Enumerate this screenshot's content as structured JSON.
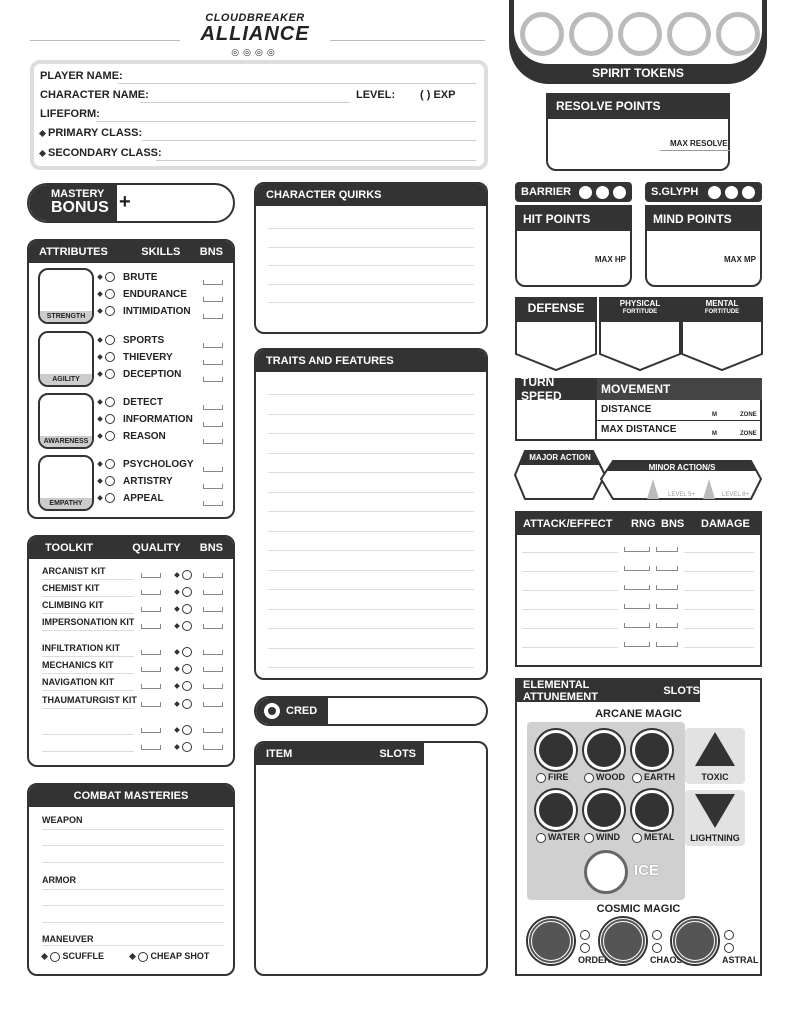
{
  "logo": {
    "line1": "CLOUDBREAKER",
    "line2": "ALLIANCE"
  },
  "identity": {
    "player": "PLAYER NAME:",
    "character": "CHARACTER NAME:",
    "level": "LEVEL:",
    "exp": "(      ) EXP",
    "lifeform": "LIFEFORM:",
    "primary": "PRIMARY CLASS:",
    "secondary": "SECONDARY CLASS:"
  },
  "spirit": {
    "label": "SPIRIT TOKENS"
  },
  "resolve": {
    "title": "RESOLVE POINTS",
    "max": "MAX RESOLVE"
  },
  "mastery": {
    "line1": "MASTERY",
    "line2": "BONUS",
    "plus": "+"
  },
  "attributes": {
    "h1": "ATTRIBUTES",
    "h2": "SKILLS",
    "h3": "BNS",
    "groups": [
      {
        "name": "STRENGTH",
        "skills": [
          "BRUTE",
          "ENDURANCE",
          "INTIMIDATION"
        ]
      },
      {
        "name": "AGILITY",
        "skills": [
          "SPORTS",
          "THIEVERY",
          "DECEPTION"
        ]
      },
      {
        "name": "AWARENESS",
        "skills": [
          "DETECT",
          "INFORMATION",
          "REASON"
        ]
      },
      {
        "name": "EMPATHY",
        "skills": [
          "PSYCHOLOGY",
          "ARTISTRY",
          "APPEAL"
        ]
      }
    ]
  },
  "toolkit": {
    "h1": "TOOLKIT",
    "h2": "QUALITY",
    "h3": "BNS",
    "items": [
      "ARCANIST KIT",
      "CHEMIST KIT",
      "CLIMBING KIT",
      "IMPERSONATION KIT",
      "INFILTRATION KIT",
      "MECHANICS KIT",
      "NAVIGATION KIT",
      "THAUMATURGIST KIT",
      "",
      ""
    ]
  },
  "combat": {
    "title": "COMBAT MASTERIES",
    "weapon": "WEAPON",
    "armor": "ARMOR",
    "maneuver": "MANEUVER",
    "scuffle": "SCUFFLE",
    "cheap": "CHEAP SHOT"
  },
  "quirks": {
    "title": "CHARACTER QUIRKS"
  },
  "traits": {
    "title": "TRAITS AND FEATURES"
  },
  "cred": {
    "label": "CRED"
  },
  "items": {
    "h1": "ITEM",
    "h2": "SLOTS"
  },
  "barrier": {
    "label": "BARRIER"
  },
  "sglyph": {
    "label": "S.GLYPH"
  },
  "hp": {
    "title": "HIT POINTS",
    "max": "MAX HP"
  },
  "mp": {
    "title": "MIND POINTS",
    "max": "MAX MP"
  },
  "defense": {
    "label": "DEFENSE"
  },
  "physical": {
    "l1": "PHYSICAL",
    "l2": "FORTITUDE"
  },
  "mental": {
    "l1": "MENTAL",
    "l2": "FORTITUDE"
  },
  "turn": {
    "speed": "TURN SPEED",
    "movement": "MOVEMENT",
    "distance": "DISTANCE",
    "maxdist": "MAX DISTANCE",
    "m": "M",
    "zone": "ZONE"
  },
  "actions": {
    "major": "MAJOR ACTION",
    "minor": "MINOR ACTION/S",
    "lv5": "LEVEL 5+",
    "lv8": "LEVEL 8+"
  },
  "attack": {
    "h1": "ATTACK/EFFECT",
    "h2": "RNG",
    "h3": "BNS",
    "h4": "DAMAGE"
  },
  "elemental": {
    "title": "ELEMENTAL ATTUNEMENT",
    "slots": "SLOTS",
    "arcane": "ARCANE MAGIC",
    "cosmic": "COSMIC MAGIC",
    "row1": [
      "FIRE",
      "WOOD",
      "EARTH"
    ],
    "row2": [
      "WATER",
      "WIND",
      "METAL"
    ],
    "toxic": "TOXIC",
    "lightning": "LIGHTNING",
    "ice": "ICE",
    "cosmicItems": [
      "ORDER",
      "CHAOS",
      "ASTRAL"
    ]
  }
}
